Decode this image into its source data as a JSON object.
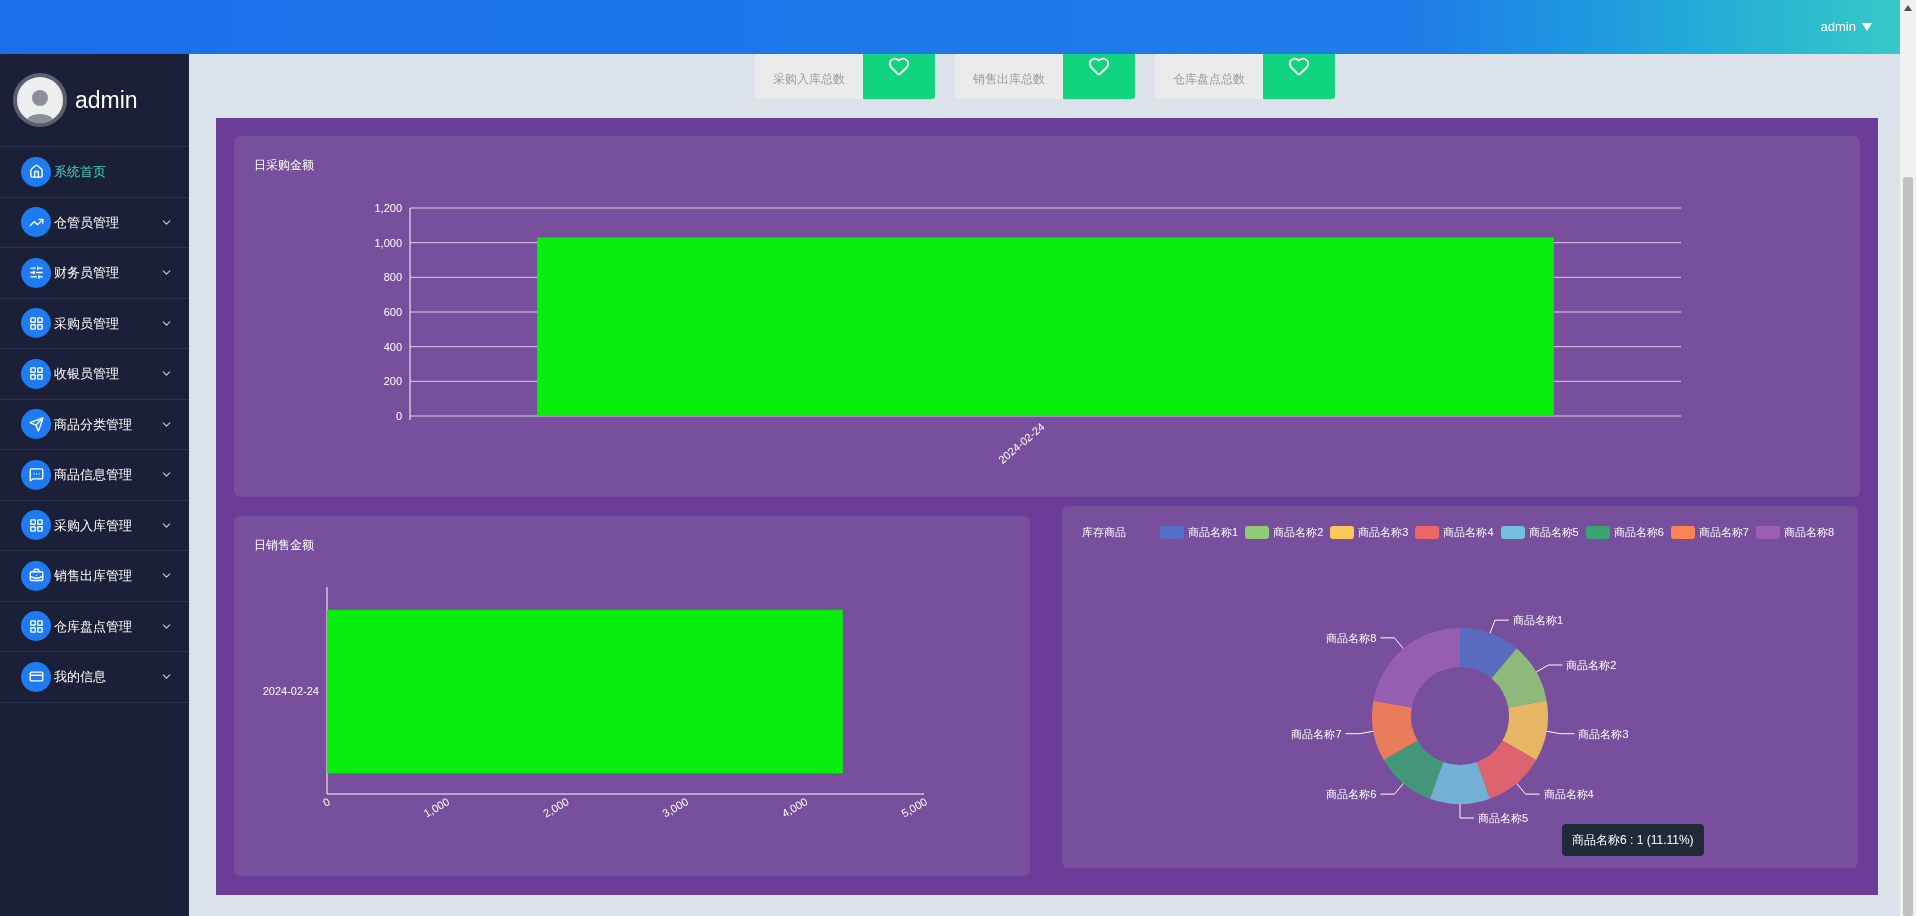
{
  "header": {
    "user": "admin"
  },
  "sidebar": {
    "user_name": "admin",
    "items": [
      {
        "label": "系统首页",
        "kind": "link",
        "selected": true
      },
      {
        "label": "仓管员管理",
        "kind": "submenu",
        "selected": false
      },
      {
        "label": "财务员管理",
        "kind": "submenu",
        "selected": false
      },
      {
        "label": "采购员管理",
        "kind": "submenu",
        "selected": false
      },
      {
        "label": "收银员管理",
        "kind": "submenu",
        "selected": false
      },
      {
        "label": "商品分类管理",
        "kind": "submenu",
        "selected": false
      },
      {
        "label": "商品信息管理",
        "kind": "submenu",
        "selected": false
      },
      {
        "label": "采购入库管理",
        "kind": "submenu",
        "selected": false
      },
      {
        "label": "销售出库管理",
        "kind": "submenu",
        "selected": false
      },
      {
        "label": "仓库盘点管理",
        "kind": "submenu",
        "selected": false
      },
      {
        "label": "我的信息",
        "kind": "submenu",
        "selected": false
      }
    ]
  },
  "stats": [
    {
      "label": "采购入库总数"
    },
    {
      "label": "销售出库总数"
    },
    {
      "label": "仓库盘点总数"
    }
  ],
  "purchase_chart": {
    "chart_data": {
      "type": "bar",
      "title": "日采购金额",
      "grid": true,
      "categories": [
        "2024-02-24"
      ],
      "values": [
        1030
      ],
      "ylim": [
        0,
        1200
      ],
      "yticks": [
        0,
        200,
        400,
        600,
        800,
        {
          "value": 1000,
          "label": "1,000"
        },
        {
          "value": 1200,
          "label": "1,200"
        }
      ]
    }
  },
  "sales_chart": {
    "chart_data": {
      "type": "bar",
      "orientation": "horizontal",
      "title": "日销售金额",
      "categories": [
        "2024-02-24"
      ],
      "values": [
        4320
      ],
      "xlim": [
        0,
        5000
      ],
      "xticks": [
        0,
        {
          "value": 1000,
          "label": "1,000"
        },
        {
          "value": 2000,
          "label": "2,000"
        },
        {
          "value": 3000,
          "label": "3,000"
        },
        {
          "value": 4000,
          "label": "4,000"
        },
        {
          "value": 5000,
          "label": "5,000"
        }
      ]
    }
  },
  "stock_chart": {
    "legend": [
      {
        "label": "商品名称1",
        "color": "#5470c6"
      },
      {
        "label": "商品名称2",
        "color": "#91cc75"
      },
      {
        "label": "商品名称3",
        "color": "#fac858"
      },
      {
        "label": "商品名称4",
        "color": "#ee6666"
      },
      {
        "label": "商品名称5",
        "color": "#73c0de"
      },
      {
        "label": "商品名称6",
        "color": "#3ba272"
      },
      {
        "label": "商品名称7",
        "color": "#fc8452"
      },
      {
        "label": "商品名称8",
        "color": "#9a60b4"
      }
    ],
    "chart_data": {
      "type": "donut",
      "title": "库存商品",
      "categories": [
        "商品名称1",
        "商品名称2",
        "商品名称3",
        "商品名称4",
        "商品名称5",
        "商品名称6",
        "商品名称7",
        "商品名称8"
      ],
      "values": [
        1,
        1,
        1,
        1,
        1,
        1,
        1,
        2
      ]
    },
    "tooltip": "商品名称6 : 1 (11.11%)"
  }
}
